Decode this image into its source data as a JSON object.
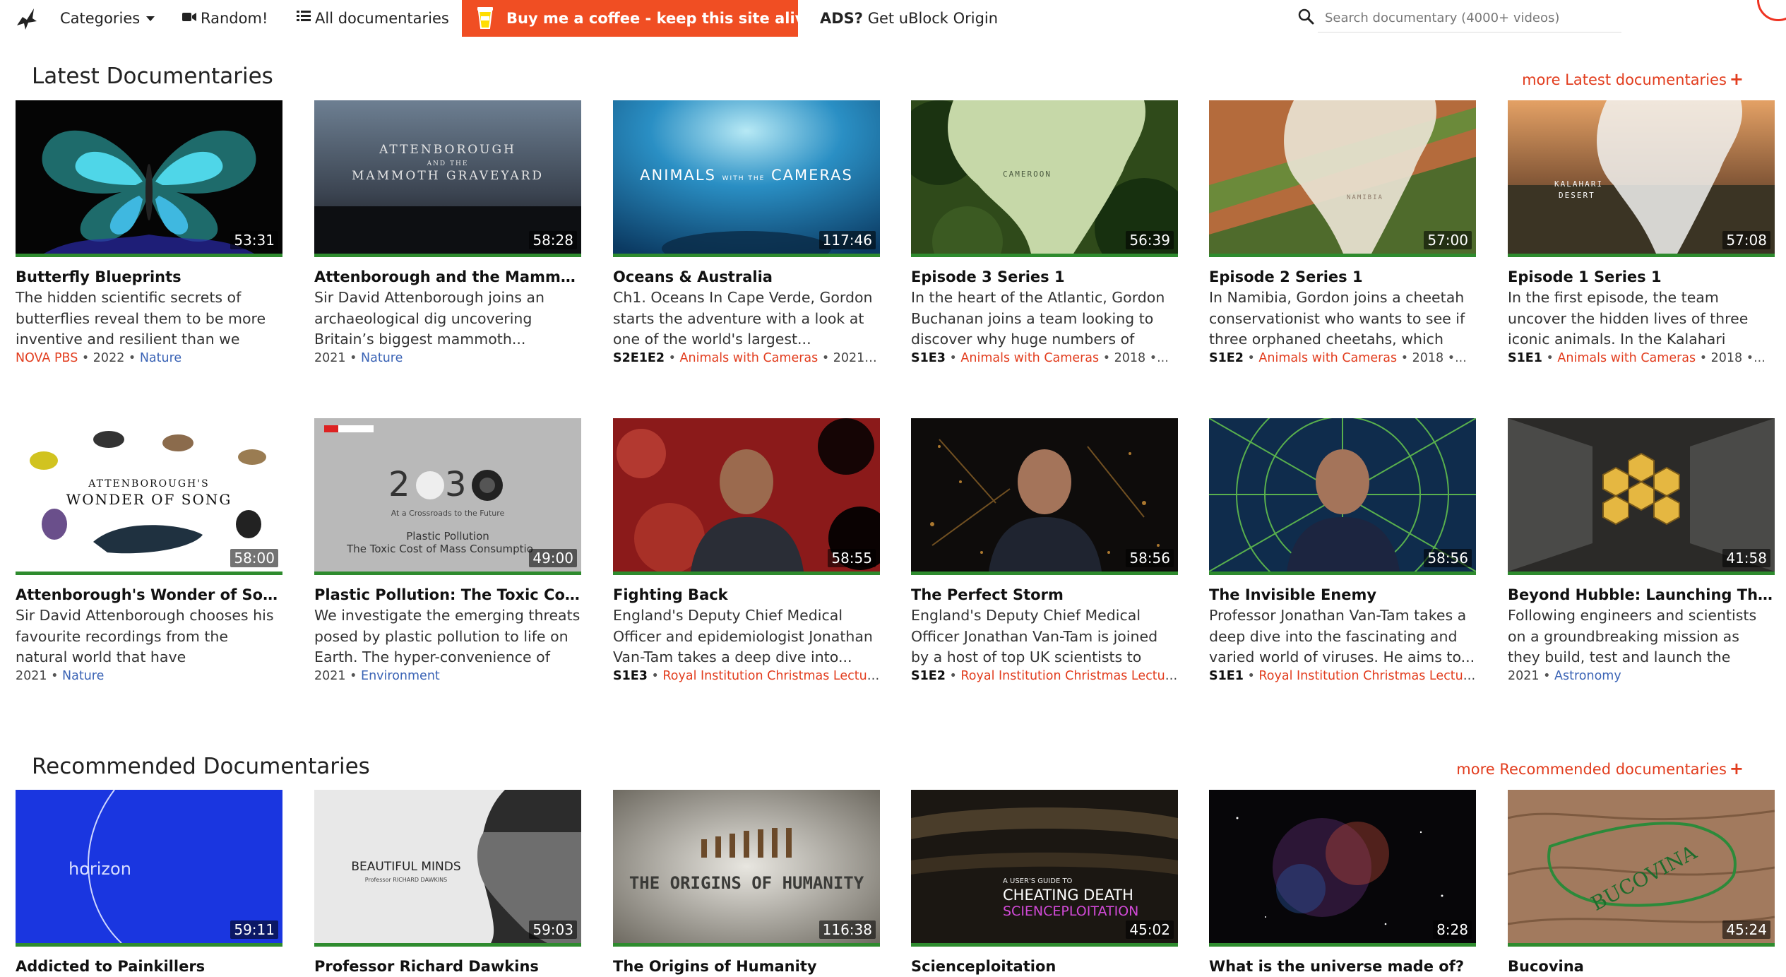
{
  "nav": {
    "categories_label": "Categories",
    "random_label": "Random!",
    "all_docs_label": "All documentaries",
    "coffee_label": "Buy me a coffee - keep this site alive",
    "ads_prefix": "ADS?",
    "ads_text": "Get uBlock Origin",
    "search_placeholder": "Search documentary (4000+ videos)"
  },
  "latest": {
    "title": "Latest Documentaries",
    "more_label": "more Latest documentaries",
    "cards": [
      {
        "title": "Butterfly Blueprints",
        "desc": "The hidden scientific secrets of butterflies reveal them to be more inventive and resilient than we ever...",
        "episode": "",
        "channel": "NOVA PBS",
        "year": "2022",
        "category": "Nature",
        "duration": "53:31",
        "thumb": "butterfly"
      },
      {
        "title": "Attenborough and the Mammoth...",
        "desc": "Sir David Attenborough joins an archaeological dig uncovering Britain’s biggest mammoth...",
        "episode": "",
        "channel": "",
        "year": "2021",
        "category": "Nature",
        "duration": "58:28",
        "thumb": "mammoth",
        "thumb_line1": "ATTENBOROUGH",
        "thumb_line2": "AND THE",
        "thumb_line3": "MAMMOTH GRAVEYARD"
      },
      {
        "title": "Oceans & Australia",
        "desc": "Ch1. Oceans In Cape Verde, Gordon starts the adventure with a look at one of the world's largest...",
        "episode": "S2E1E2",
        "channel": "Animals with Cameras",
        "year": "2021",
        "category": "",
        "duration": "117:46",
        "thumb": "oceans",
        "thumb_line1": "ANIMALS",
        "thumb_line2": "WITH THE",
        "thumb_line3": "CAMERAS"
      },
      {
        "title": "Episode 3 Series 1",
        "desc": "In the heart of the Atlantic, Gordon Buchanan joins a team looking to discover why huge numbers of devi...",
        "episode": "S1E3",
        "channel": "Animals with Cameras",
        "year": "2018",
        "category": "",
        "duration": "56:39",
        "thumb": "africa-forest",
        "thumb_line1": "CAMEROON"
      },
      {
        "title": "Episode 2 Series 1",
        "desc": "In Namibia, Gordon joins a cheetah conservationist who wants to see if three orphaned cheetahs, which sh...",
        "episode": "S1E2",
        "channel": "Animals with Cameras",
        "year": "2018",
        "category": "",
        "duration": "57:00",
        "thumb": "africa-road",
        "thumb_line1": "NAMIBIA"
      },
      {
        "title": "Episode 1 Series 1",
        "desc": "In the first episode, the team uncover the hidden lives of three iconic animals. In the Kalahari Desert the...",
        "episode": "S1E1",
        "channel": "Animals with Cameras",
        "year": "2018",
        "category": "",
        "duration": "57:08",
        "thumb": "africa-desert",
        "thumb_line1": "KALAHARI",
        "thumb_line2": "DESERT"
      },
      {
        "title": "Attenborough's Wonder of Song",
        "desc": "Sir David Attenborough chooses his favourite recordings from the natural world that have revolutionised our...",
        "episode": "",
        "channel": "",
        "year": "2021",
        "category": "Nature",
        "duration": "58:00",
        "thumb": "song",
        "thumb_line1": "ATTENBOROUGH'S",
        "thumb_line2": "WONDER OF SONG"
      },
      {
        "title": "Plastic Pollution: The Toxic Cost o...",
        "desc": "We investigate the emerging threats posed by plastic pollution to life on Earth. The hyper-convenience of ou...",
        "episode": "",
        "channel": "",
        "year": "2021",
        "category": "Environment",
        "duration": "49:00",
        "thumb": "plastic",
        "thumb_line1": "2030",
        "thumb_line2": "At a Crossroads to the Future",
        "thumb_line3": "Plastic Pollution",
        "thumb_line4": "The Toxic Cost of Mass Consumptio"
      },
      {
        "title": "Fighting Back",
        "desc": "England's Deputy Chief Medical Officer and epidemiologist Jonathan Van-Tam takes a deep dive into...",
        "episode": "S1E3",
        "channel": "Royal Institution Christmas Lecture...",
        "year": "",
        "category": "",
        "duration": "58:55",
        "thumb": "man-red"
      },
      {
        "title": "The Perfect Storm",
        "desc": "England's Deputy Chief Medical Officer Jonathan Van-Tam is joined by a host of top UK scientists to tak...",
        "episode": "S1E2",
        "channel": "Royal Institution Christmas Lecture...",
        "year": "",
        "category": "",
        "duration": "58:56",
        "thumb": "man-city"
      },
      {
        "title": "The Invisible Enemy",
        "desc": "Professor Jonathan Van-Tam takes a deep dive into the fascinating and varied world of viruses. He aims to...",
        "episode": "S1E1",
        "channel": "Royal Institution Christmas Lecture...",
        "year": "",
        "category": "",
        "duration": "58:56",
        "thumb": "man-net"
      },
      {
        "title": "Beyond Hubble: Launching The...",
        "desc": "Following engineers and scientists on a groundbreaking mission as they build, test and launch the James...",
        "episode": "",
        "channel": "",
        "year": "2021",
        "category": "Astronomy",
        "duration": "41:58",
        "thumb": "hubble"
      }
    ]
  },
  "recommended": {
    "title": "Recommended Documentaries",
    "more_label": "more Recommended documentaries",
    "cards": [
      {
        "title": "Addicted to Painkillers",
        "duration": "59:11",
        "thumb": "horizon",
        "thumb_line1": "horizon"
      },
      {
        "title": "Professor Richard Dawkins",
        "duration": "59:03",
        "thumb": "dawkins",
        "thumb_line1": "BEAUTIFUL MINDS",
        "thumb_line2": "Professor RICHARD DAWKINS"
      },
      {
        "title": "The Origins of Humanity",
        "duration": "116:38",
        "thumb": "origins",
        "thumb_line1": "THE ORIGINS OF HUMANITY"
      },
      {
        "title": "Scienceploitation",
        "duration": "45:02",
        "thumb": "cheating",
        "thumb_line1": "A USER'S GUIDE TO",
        "thumb_line2": "CHEATING DEATH",
        "thumb_line3": "SCIENCEPLOITATION"
      },
      {
        "title": "What is the universe made of?",
        "duration": "8:28",
        "thumb": "universe"
      },
      {
        "title": "Bucovina",
        "duration": "45:24",
        "thumb": "bucovina",
        "thumb_line1": "BUCOVINA"
      }
    ]
  },
  "colors": {
    "accent": "#f04e23",
    "link_red": "#e23d1e",
    "link_blue": "#3a63b5",
    "progress_green": "#2e8b2e"
  }
}
